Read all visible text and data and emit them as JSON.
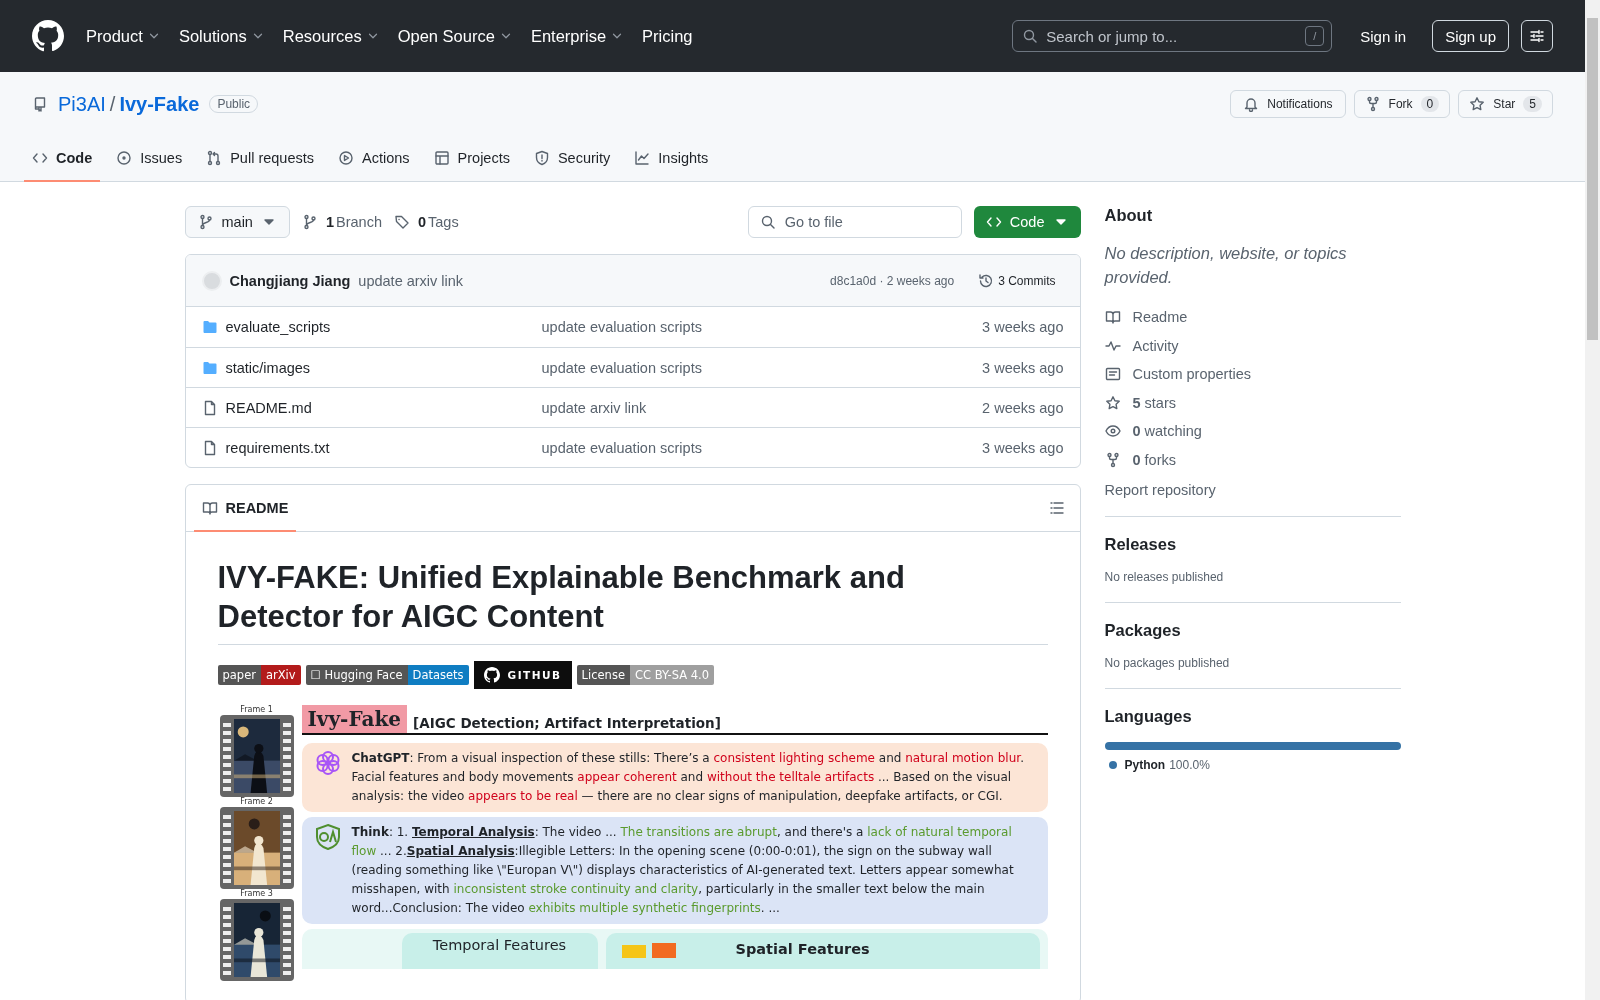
{
  "header": {
    "nav": [
      {
        "label": "Product",
        "dropdown": true
      },
      {
        "label": "Solutions",
        "dropdown": true
      },
      {
        "label": "Resources",
        "dropdown": true
      },
      {
        "label": "Open Source",
        "dropdown": true
      },
      {
        "label": "Enterprise",
        "dropdown": true
      },
      {
        "label": "Pricing",
        "dropdown": false
      }
    ],
    "search": {
      "placeholder": "Search or jump to...",
      "shortcut": "/"
    },
    "sign_in": "Sign in",
    "sign_up": "Sign up"
  },
  "repo": {
    "owner": "Pi3AI",
    "separator": "/",
    "name": "Ivy-Fake",
    "visibility": "Public",
    "actions": [
      {
        "kind": "notifications",
        "label": "Notifications"
      },
      {
        "kind": "fork",
        "label": "Fork",
        "count": "0"
      },
      {
        "kind": "star",
        "label": "Star",
        "count": "5"
      }
    ]
  },
  "tabs": [
    {
      "kind": "code",
      "label": "Code",
      "selected": true
    },
    {
      "kind": "issues",
      "label": "Issues",
      "selected": false
    },
    {
      "kind": "pulls",
      "label": "Pull requests",
      "selected": false
    },
    {
      "kind": "actions",
      "label": "Actions",
      "selected": false
    },
    {
      "kind": "projects",
      "label": "Projects",
      "selected": false
    },
    {
      "kind": "security",
      "label": "Security",
      "selected": false
    },
    {
      "kind": "insights",
      "label": "Insights",
      "selected": false
    }
  ],
  "toolbar": {
    "branch": "main",
    "branches": {
      "count": "1",
      "label": "Branch"
    },
    "tags": {
      "count": "0",
      "label": "Tags"
    },
    "file_search": {
      "placeholder": "Go to file"
    },
    "code_button": "Code"
  },
  "latest_commit": {
    "author": "Changjiang Jiang",
    "message": "update arxiv link",
    "hash_time": "d8c1a0d · 2 weeks ago",
    "commits": "3 Commits"
  },
  "files": [
    {
      "kind": "folder",
      "name": "evaluate_scripts",
      "message": "update evaluation scripts",
      "time": "3 weeks ago"
    },
    {
      "kind": "folder",
      "name": "static/images",
      "message": "update evaluation scripts",
      "time": "3 weeks ago"
    },
    {
      "kind": "file",
      "name": "README.md",
      "message": "update arxiv link",
      "time": "2 weeks ago"
    },
    {
      "kind": "file",
      "name": "requirements.txt",
      "message": "update evaluation scripts",
      "time": "3 weeks ago"
    }
  ],
  "readme": {
    "tab": "README",
    "title": "IVY-FAKE: Unified Explainable Benchmark and Detector for AIGC Content",
    "badges": [
      {
        "kind": "split",
        "left": "paper",
        "right": "arXiv",
        "color": "#b31b1b"
      },
      {
        "kind": "split",
        "left": "☐ Hugging Face",
        "right": "Datasets",
        "color": "#0f7dc2"
      },
      {
        "kind": "github",
        "label": "GITHUB"
      },
      {
        "kind": "split",
        "left": "License",
        "right": "CC BY-SA 4.0",
        "color": "#9f9f9f"
      }
    ],
    "figure": {
      "frames": [
        {
          "label": "Frame 1",
          "kind": "picture"
        },
        {
          "label": "Frame 2",
          "kind": "picture"
        },
        {
          "label": "Frame 3",
          "kind": "picture"
        }
      ],
      "title": "Ivy-Fake",
      "subtitle": "[AIGC Detection; Artifact Interpretation]",
      "cards": [
        {
          "kind": "chatgpt",
          "color": "#d0021b",
          "segments": [
            {
              "kind": "speaker",
              "text": "ChatGPT"
            },
            {
              "kind": "plain",
              "text": ": From a visual inspection of these stills: There’s a "
            },
            {
              "kind": "accent",
              "text": "consistent lighting scheme"
            },
            {
              "kind": "plain",
              "text": " and "
            },
            {
              "kind": "accent",
              "text": "natural motion blur"
            },
            {
              "kind": "plain",
              "text": ". Facial features and body movements "
            },
            {
              "kind": "accent",
              "text": "appear coherent"
            },
            {
              "kind": "plain",
              "text": " and "
            },
            {
              "kind": "accent",
              "text": "without the telltale artifacts"
            },
            {
              "kind": "plain",
              "text": " ... Based on the visual analysis: the video "
            },
            {
              "kind": "accent",
              "text": "appears to be real"
            },
            {
              "kind": "plain",
              "text": " — there are no clear signs of manipulation, deepfake artifacts, or CGI."
            }
          ]
        },
        {
          "kind": "qa",
          "color": "#5a9a2e",
          "segments": [
            {
              "kind": "speaker",
              "text": "Think"
            },
            {
              "kind": "plain",
              "text": ": 1. "
            },
            {
              "kind": "term",
              "text": "Temporal Analysis"
            },
            {
              "kind": "plain",
              "text": ": The video ... "
            },
            {
              "kind": "accent",
              "text": "The transitions are abrupt"
            },
            {
              "kind": "plain",
              "text": ", and there's a "
            },
            {
              "kind": "accent",
              "text": "lack of natural temporal flow"
            },
            {
              "kind": "plain",
              "text": " ... 2."
            },
            {
              "kind": "term",
              "text": "Spatial Analysis"
            },
            {
              "kind": "plain",
              "text": ":Illegible Letters: In the opening scene (0:00-0:01), the sign on the subway wall (reading something like \\\"Europan V\\\") displays characteristics of AI-generated text. Letters appear somewhat misshapen, with "
            },
            {
              "kind": "accent",
              "text": "inconsistent stroke continuity and clarity"
            },
            {
              "kind": "plain",
              "text": ", particularly in the smaller text below the main word...Conclusion: The video "
            },
            {
              "kind": "accent",
              "text": "exhibits multiple synthetic fingerprints"
            },
            {
              "kind": "plain",
              "text": ". ..."
            }
          ]
        }
      ],
      "features": [
        {
          "kind": "temporal",
          "label": "Temporal Features"
        },
        {
          "kind": "spatial",
          "label": "Spatial Features"
        }
      ]
    }
  },
  "about": {
    "title": "About",
    "description": "No description, website, or topics provided.",
    "links": [
      {
        "kind": "readme",
        "label": "Readme"
      },
      {
        "kind": "activity",
        "label": "Activity"
      },
      {
        "kind": "properties",
        "label": "Custom properties"
      },
      {
        "kind": "stars",
        "count": "5",
        "label": "stars"
      },
      {
        "kind": "watching",
        "count": "0",
        "label": "watching"
      },
      {
        "kind": "forks",
        "count": "0",
        "label": "forks"
      }
    ],
    "report": "Report repository"
  },
  "releases": {
    "title": "Releases",
    "empty": "No releases published"
  },
  "packages": {
    "title": "Packages",
    "empty": "No packages published"
  },
  "languages": {
    "title": "Languages",
    "items": [
      {
        "name": "Python",
        "percent": "100.0%",
        "level": 1,
        "color": "#3572a5"
      }
    ]
  }
}
